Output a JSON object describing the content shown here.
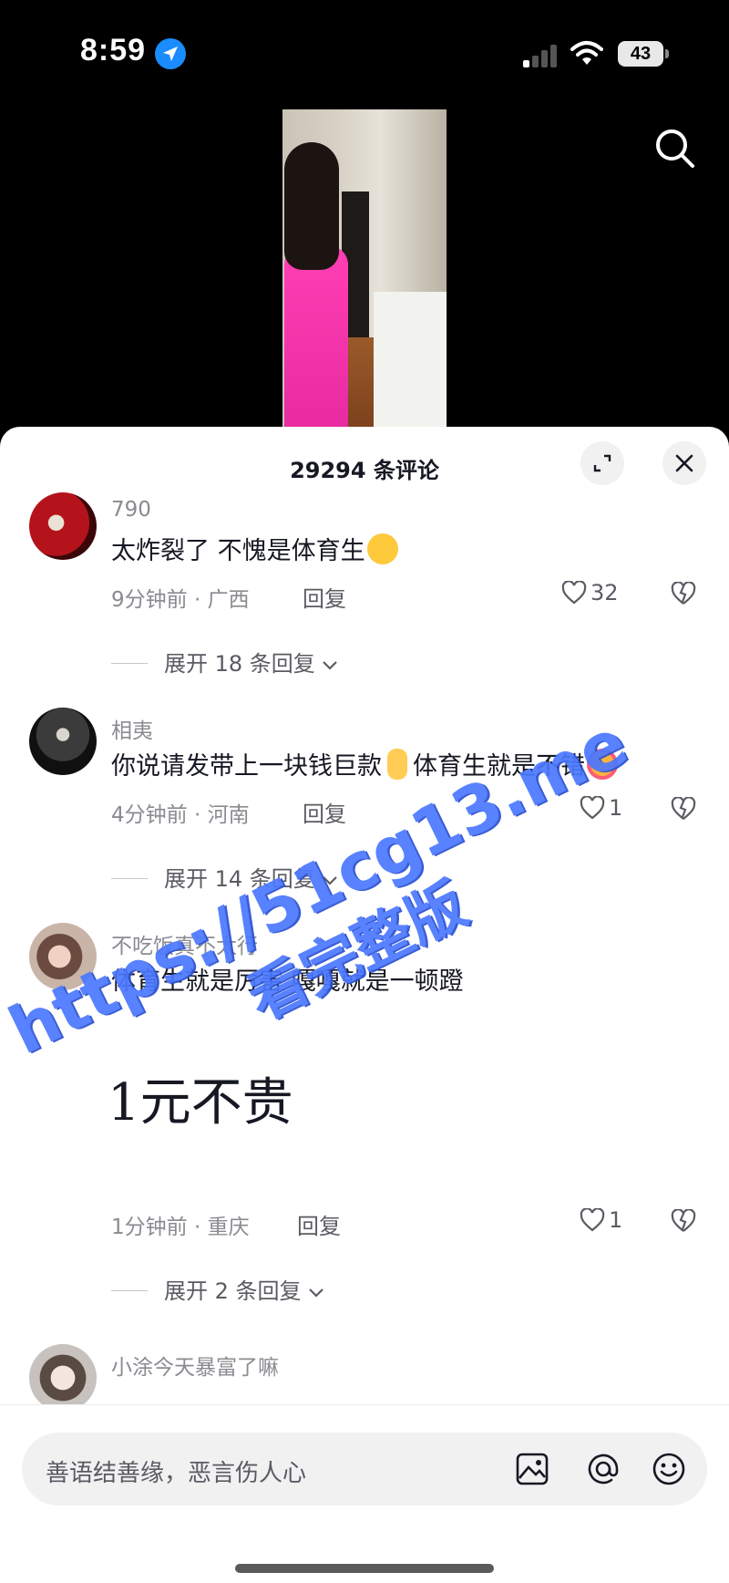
{
  "status_bar": {
    "time": "8:59",
    "battery": "43"
  },
  "comments_header": {
    "count_label": "29294 条评论"
  },
  "comments": [
    {
      "user": "790",
      "text": "太炸裂了 不愧是体育生",
      "meta": "9分钟前 · 广西",
      "reply_label": "回复",
      "likes": "32",
      "expand_label": "展开 18 条回复"
    },
    {
      "user": "相夷",
      "text_part1": "你说请发带上一块钱巨款",
      "text_part2": "体育生就是不错",
      "meta": "4分钟前 · 河南",
      "reply_label": "回复",
      "likes": "1",
      "expand_label": "展开 14 条回复"
    },
    {
      "user": "不吃饭真不太行",
      "text": "体育生就是厉害 嘎嘎就是一顿蹬",
      "image_text": "1元不贵",
      "meta": "1分钟前 · 重庆",
      "reply_label": "回复",
      "likes": "1",
      "expand_label": "展开 2 条回复"
    },
    {
      "user": "小涂今天暴富了嘛"
    }
  ],
  "input": {
    "placeholder": "善语结善缘，恶言伤人心"
  },
  "watermark": {
    "line1": "https://51cg13.me",
    "line2": "看完整版"
  }
}
